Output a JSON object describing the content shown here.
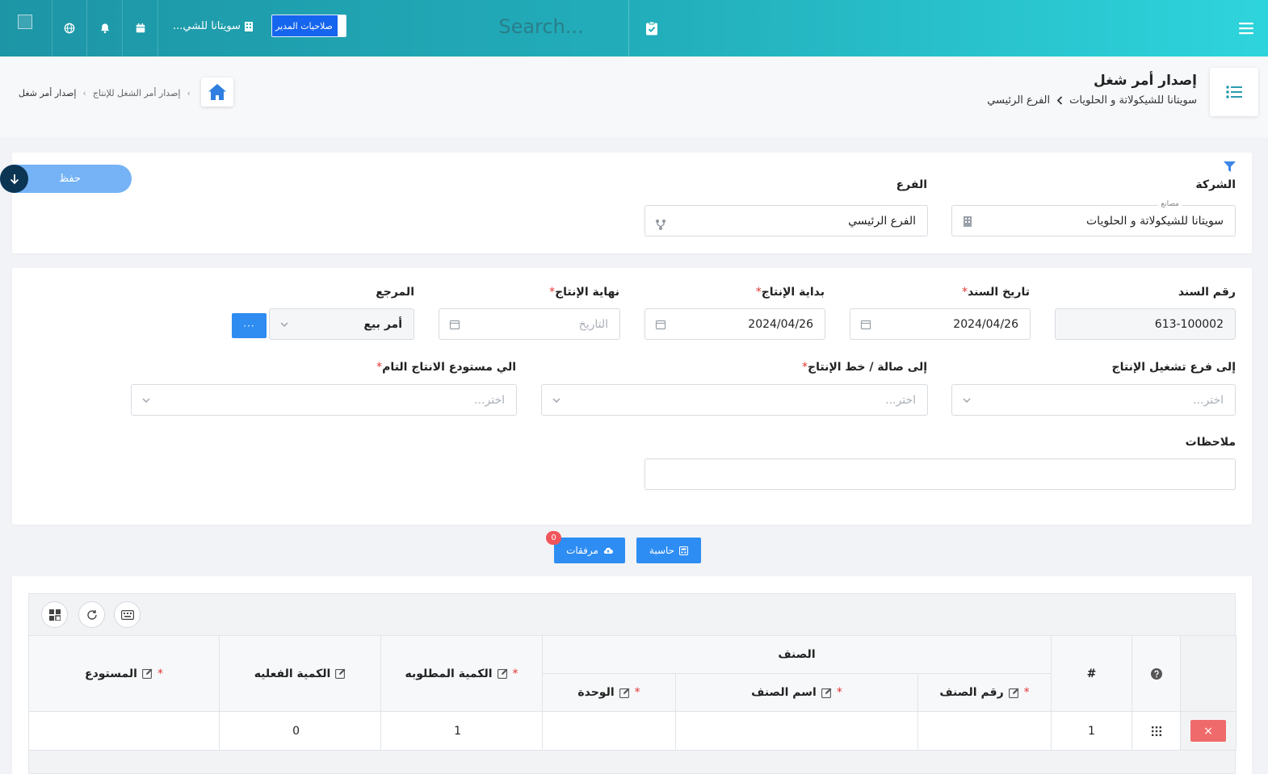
{
  "header": {
    "search_placeholder": "Search...",
    "company_short": "سويتانا للشي...",
    "permissions_label": "صلاحيات المدير"
  },
  "page": {
    "title": "إصدار أمر شغل",
    "company": "سويتانا للشيكولاتة و الحلويات",
    "branch": "الفرع الرئيسي",
    "breadcrumb": [
      "إصدار أمر الشغل للإنتاج",
      "إصدار أمر شغل"
    ]
  },
  "filter": {
    "company_label": "الشركة",
    "company_float": "مصانع",
    "company_value": "سويتانا للشيكولاتة و الحلويات",
    "branch_label": "الفرع",
    "branch_value": "الفرع الرئيسي",
    "save_label": "حفظ"
  },
  "form": {
    "doc_no_label": "رقم السند",
    "doc_no_value": "613-100002",
    "doc_date_label": "تاريخ السند",
    "doc_date_value": "2024/04/26",
    "start_label": "بداية الإنتاج",
    "start_value": "2024/04/26",
    "end_label": "نهاية الإنتاج",
    "end_placeholder": "التاريخ",
    "ref_label": "المرجع",
    "ref_value": "أمر بيع",
    "ref_more": "···",
    "op_branch_label": "إلى فرع تشغيل الإنتاج",
    "hall_label": "إلى صالة / خط الإنتاج",
    "warehouse_label": "الي مستودع الانتاج التام",
    "choose_placeholder": "اختر...",
    "notes_label": "ملاحظات"
  },
  "actions": {
    "calc_label": "حاسبة",
    "attach_label": "مرفقات",
    "attach_count": "0"
  },
  "grid": {
    "group_header": "الصنف",
    "columns": {
      "hash": "#",
      "item_no": "رقم الصنف",
      "item_name": "اسم الصنف",
      "unit": "الوحدة",
      "req_qty": "الكمية المطلوبه",
      "actual_qty": "الكمية الفعليه",
      "warehouse": "المستودع"
    },
    "rows": [
      {
        "index": "1",
        "item_no": "",
        "item_name": "",
        "unit": "",
        "req_qty": "1",
        "actual_qty": "0",
        "warehouse": ""
      }
    ],
    "delete_symbol": "×"
  },
  "colors": {
    "accent": "#2e8df3",
    "header_start": "#1d95a6",
    "header_end": "#2ed4dc",
    "danger": "#ef6b6b"
  }
}
